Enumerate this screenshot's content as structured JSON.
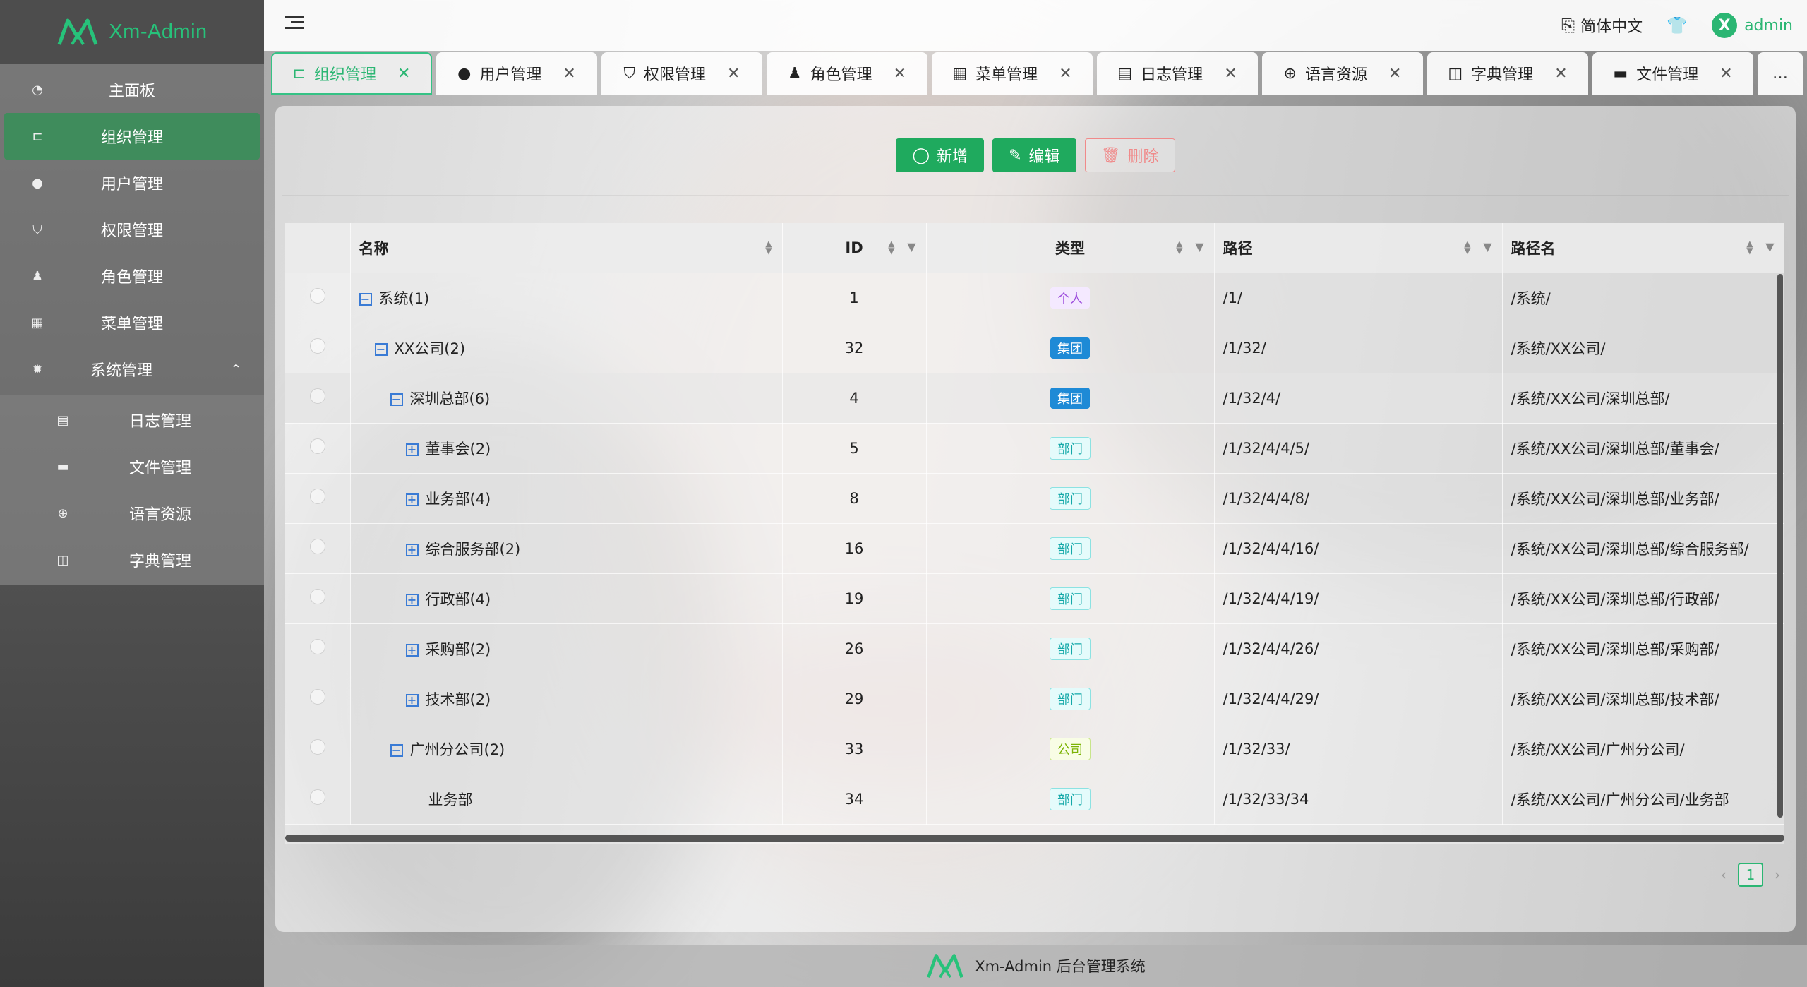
{
  "app": {
    "name": "Xm-Admin",
    "footer_text": "Xm-Admin 后台管理系统"
  },
  "colors": {
    "brand_green": "#2bb673",
    "active_menu_bg": "#3f8c5c",
    "danger": "#f08a8a",
    "tag_group": "#1e8ad6"
  },
  "sidebar": {
    "items": [
      {
        "label": "主面板",
        "icon": "dashboard-icon"
      },
      {
        "label": "组织管理",
        "icon": "org-chart-icon",
        "active": true
      },
      {
        "label": "用户管理",
        "icon": "user-icon"
      },
      {
        "label": "权限管理",
        "icon": "shield-icon"
      },
      {
        "label": "角色管理",
        "icon": "role-icon"
      },
      {
        "label": "菜单管理",
        "icon": "grid-icon"
      },
      {
        "label": "系统管理",
        "icon": "gear-icon",
        "expanded": true
      }
    ],
    "subitems": [
      {
        "label": "日志管理",
        "icon": "log-icon"
      },
      {
        "label": "文件管理",
        "icon": "folder-icon"
      },
      {
        "label": "语言资源",
        "icon": "globe-icon"
      },
      {
        "label": "字典管理",
        "icon": "book-icon"
      }
    ]
  },
  "header": {
    "language": "简体中文",
    "username": "admin"
  },
  "tabs": [
    {
      "label": "组织管理",
      "icon": "org-chart-icon",
      "active": true
    },
    {
      "label": "用户管理",
      "icon": "user-icon"
    },
    {
      "label": "权限管理",
      "icon": "shield-icon"
    },
    {
      "label": "角色管理",
      "icon": "role-icon"
    },
    {
      "label": "菜单管理",
      "icon": "grid-icon"
    },
    {
      "label": "日志管理",
      "icon": "log-icon"
    },
    {
      "label": "语言资源",
      "icon": "globe-icon"
    },
    {
      "label": "字典管理",
      "icon": "book-icon"
    },
    {
      "label": "文件管理",
      "icon": "folder-icon"
    }
  ],
  "tabs_more": "…",
  "toolbar": {
    "add": "新增",
    "edit": "编辑",
    "delete": "删除"
  },
  "table": {
    "columns": {
      "name": "名称",
      "id": "ID",
      "type": "类型",
      "path": "路径",
      "path_name": "路径名"
    },
    "rows": [
      {
        "name": "系统(1)",
        "id": "1",
        "type": "个人",
        "type_style": "personal",
        "path": "/1/",
        "path_name": "/系统/",
        "expander": "minus",
        "indent": 0
      },
      {
        "name": "XX公司(2)",
        "id": "32",
        "type": "集团",
        "type_style": "group",
        "path": "/1/32/",
        "path_name": "/系统/XX公司/",
        "expander": "minus",
        "indent": 1
      },
      {
        "name": "深圳总部(6)",
        "id": "4",
        "type": "集团",
        "type_style": "group",
        "path": "/1/32/4/",
        "path_name": "/系统/XX公司/深圳总部/",
        "expander": "minus",
        "indent": 2,
        "highlight": true
      },
      {
        "name": "董事会(2)",
        "id": "5",
        "type": "部门",
        "type_style": "dept",
        "path": "/1/32/4/4/5/",
        "path_name": "/系统/XX公司/深圳总部/董事会/",
        "expander": "plus",
        "indent": 3
      },
      {
        "name": "业务部(4)",
        "id": "8",
        "type": "部门",
        "type_style": "dept",
        "path": "/1/32/4/4/8/",
        "path_name": "/系统/XX公司/深圳总部/业务部/",
        "expander": "plus",
        "indent": 3
      },
      {
        "name": "综合服务部(2)",
        "id": "16",
        "type": "部门",
        "type_style": "dept",
        "path": "/1/32/4/4/16/",
        "path_name": "/系统/XX公司/深圳总部/综合服务部/",
        "expander": "plus",
        "indent": 3
      },
      {
        "name": "行政部(4)",
        "id": "19",
        "type": "部门",
        "type_style": "dept",
        "path": "/1/32/4/4/19/",
        "path_name": "/系统/XX公司/深圳总部/行政部/",
        "expander": "plus",
        "indent": 3
      },
      {
        "name": "采购部(2)",
        "id": "26",
        "type": "部门",
        "type_style": "dept",
        "path": "/1/32/4/4/26/",
        "path_name": "/系统/XX公司/深圳总部/采购部/",
        "expander": "plus",
        "indent": 3
      },
      {
        "name": "技术部(2)",
        "id": "29",
        "type": "部门",
        "type_style": "dept",
        "path": "/1/32/4/4/29/",
        "path_name": "/系统/XX公司/深圳总部/技术部/",
        "expander": "plus",
        "indent": 3
      },
      {
        "name": "广州分公司(2)",
        "id": "33",
        "type": "公司",
        "type_style": "company",
        "path": "/1/32/33/",
        "path_name": "/系统/XX公司/广州分公司/",
        "expander": "minus",
        "indent": 2
      },
      {
        "name": "业务部",
        "id": "34",
        "type": "部门",
        "type_style": "dept",
        "path": "/1/32/33/34",
        "path_name": "/系统/XX公司/广州分公司/业务部",
        "expander": "none",
        "indent": 3
      }
    ]
  },
  "pagination": {
    "current_page": "1"
  }
}
